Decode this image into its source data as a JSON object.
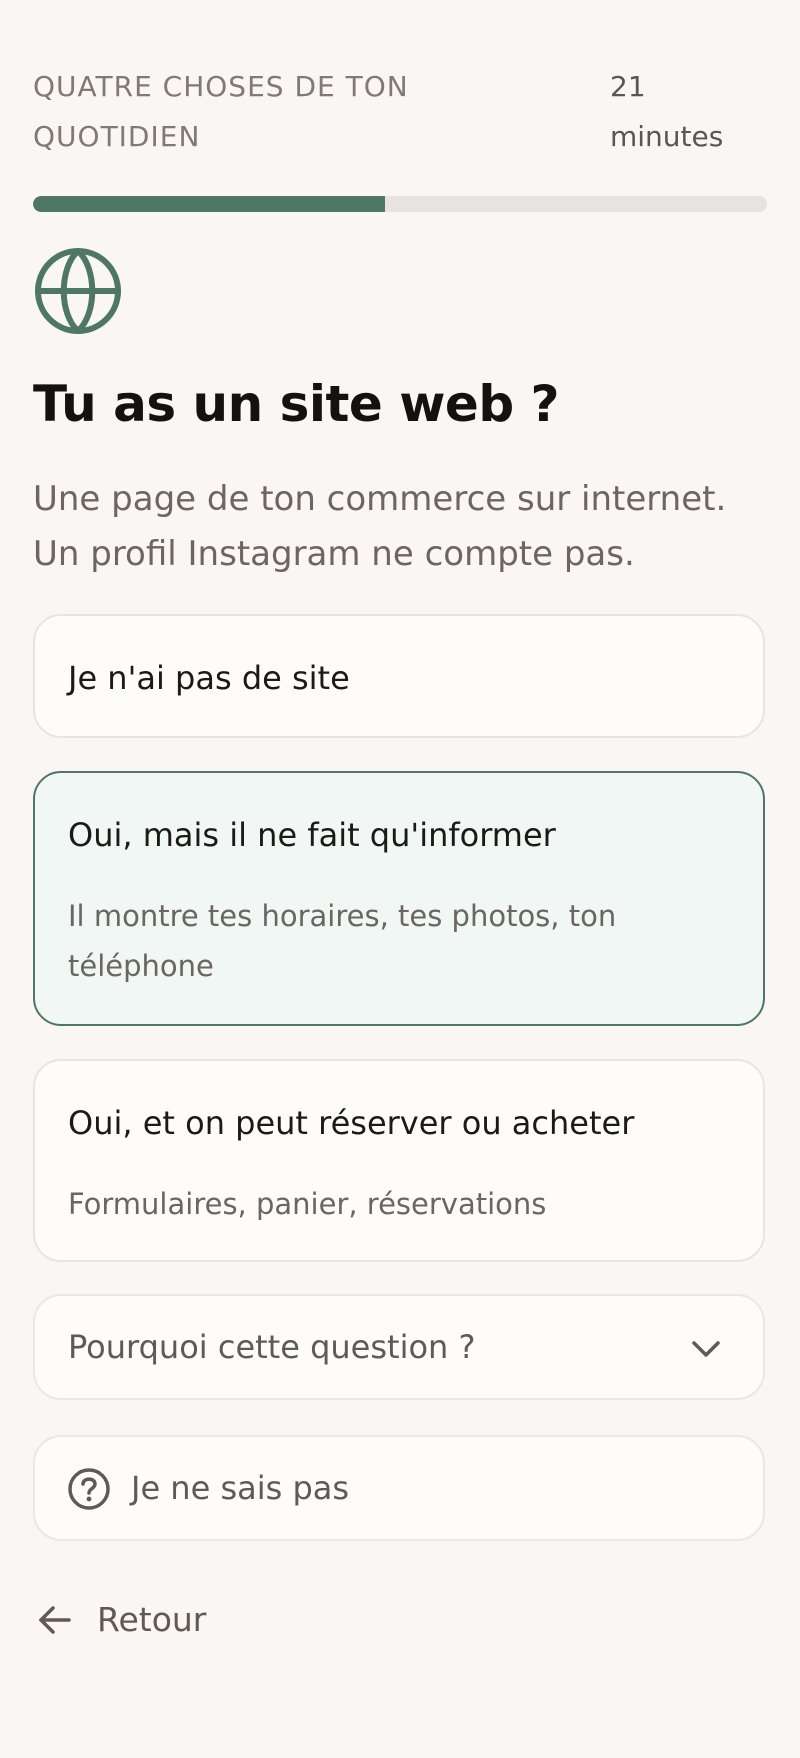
{
  "header": {
    "section_label": "QUATRE CHOSES DE TON QUOTIDIEN",
    "time_label": "21 minutes"
  },
  "progress": {
    "fraction": 0.48,
    "fill_color": "#4f7766"
  },
  "question": {
    "icon": "globe-icon",
    "title": "Tu as un site web ?",
    "subtitle": "Une page de ton commerce sur internet. Un profil Instagram ne compte pas."
  },
  "options": [
    {
      "title": "Je n'ai pas de site",
      "description": "",
      "selected": false
    },
    {
      "title": "Oui, mais il ne fait qu'informer",
      "description": "Il montre tes horaires, tes photos, ton téléphone",
      "selected": true
    },
    {
      "title": "Oui, et on peut réserver ou acheter",
      "description": "Formulaires, panier, réservations",
      "selected": false
    }
  ],
  "why": {
    "label": "Pourquoi cette question ?",
    "icon": "chevron-down-icon"
  },
  "unknown": {
    "label": "Je ne sais pas",
    "icon": "question-circle-icon"
  },
  "back": {
    "label": "Retour",
    "icon": "arrow-left-icon"
  },
  "colors": {
    "accent": "#4f7766",
    "background": "#f9f6f3",
    "selected_background": "#f0f7f4"
  }
}
